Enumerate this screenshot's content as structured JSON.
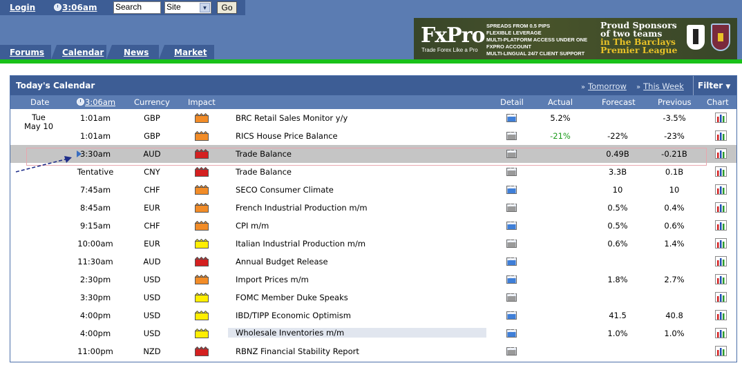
{
  "header": {
    "login_label": "Login",
    "time_label": "3:06am",
    "search_value": "Search",
    "site_select": "Site",
    "go_label": "Go",
    "nav": [
      {
        "label": "Forums"
      },
      {
        "label": "Calendar"
      },
      {
        "label": "News"
      },
      {
        "label": "Market"
      }
    ]
  },
  "ad": {
    "logo": "FxPro",
    "tagline": "Trade Forex Like a Pro",
    "features": [
      "SPREADS FROM 0.5 PIPS",
      "FLEXIBLE LEVERAGE",
      "MULTI-PLATFORM ACCESS UNDER ONE",
      "FXPRO ACCOUNT",
      "MULTI-LINGUAL 24/7 CLIENT SUPPORT"
    ],
    "sponsor_line1": "Proud Sponsors",
    "sponsor_line2": "of two teams",
    "sponsor_line3": "in The Barclays",
    "sponsor_line4": "Premier League"
  },
  "calendar": {
    "title": "Today's Calendar",
    "tomorrow_link": "Tomorrow",
    "this_week_link": "This Week",
    "filter_label": "Filter",
    "columns": {
      "date": "Date",
      "time": "3:06am",
      "currency": "Currency",
      "impact": "Impact",
      "detail": "Detail",
      "actual": "Actual",
      "forecast": "Forecast",
      "previous": "Previous",
      "chart": "Chart"
    },
    "date_label_line1": "Tue",
    "date_label_line2": "May 10",
    "rows": [
      {
        "time": "1:01am",
        "currency": "GBP",
        "impact": "medium",
        "event": "BRC Retail Sales Monitor y/y",
        "actual": "5.2%",
        "forecast": "",
        "previous": "-3.5%",
        "detail": "new"
      },
      {
        "time": "1:01am",
        "currency": "GBP",
        "impact": "medium",
        "event": "RICS House Price Balance",
        "actual": "-21%",
        "forecast": "-22%",
        "previous": "-23%",
        "detail": "seen"
      },
      {
        "time": "3:30am",
        "currency": "AUD",
        "impact": "high",
        "event": "Trade Balance",
        "actual": "",
        "forecast": "0.49B",
        "previous": "-0.21B",
        "detail": "seen"
      },
      {
        "time": "Tentative",
        "currency": "CNY",
        "impact": "high",
        "event": "Trade Balance",
        "actual": "",
        "forecast": "3.3B",
        "previous": "0.1B",
        "detail": "seen"
      },
      {
        "time": "7:45am",
        "currency": "CHF",
        "impact": "medium",
        "event": "SECO Consumer Climate",
        "actual": "",
        "forecast": "10",
        "previous": "10",
        "detail": "new"
      },
      {
        "time": "8:45am",
        "currency": "EUR",
        "impact": "medium",
        "event": "French Industrial Production m/m",
        "actual": "",
        "forecast": "0.5%",
        "previous": "0.4%",
        "detail": "seen"
      },
      {
        "time": "9:15am",
        "currency": "CHF",
        "impact": "medium",
        "event": "CPI m/m",
        "actual": "",
        "forecast": "0.5%",
        "previous": "0.6%",
        "detail": "new"
      },
      {
        "time": "10:00am",
        "currency": "EUR",
        "impact": "low",
        "event": "Italian Industrial Production m/m",
        "actual": "",
        "forecast": "0.6%",
        "previous": "1.4%",
        "detail": "seen"
      },
      {
        "time": "11:30am",
        "currency": "AUD",
        "impact": "high",
        "event": "Annual Budget Release",
        "actual": "",
        "forecast": "",
        "previous": "",
        "detail": "new"
      },
      {
        "time": "2:30pm",
        "currency": "USD",
        "impact": "medium",
        "event": "Import Prices m/m",
        "actual": "",
        "forecast": "1.8%",
        "previous": "2.7%",
        "detail": "new"
      },
      {
        "time": "3:30pm",
        "currency": "USD",
        "impact": "low",
        "event": "FOMC Member Duke Speaks",
        "actual": "",
        "forecast": "",
        "previous": "",
        "detail": "seen"
      },
      {
        "time": "4:00pm",
        "currency": "USD",
        "impact": "low",
        "event": "IBD/TIPP Economic Optimism",
        "actual": "",
        "forecast": "41.5",
        "previous": "40.8",
        "detail": "new"
      },
      {
        "time": "4:00pm",
        "currency": "USD",
        "impact": "low",
        "event": "Wholesale Inventories m/m",
        "actual": "",
        "forecast": "1.0%",
        "previous": "1.0%",
        "detail": "new"
      },
      {
        "time": "11:00pm",
        "currency": "NZD",
        "impact": "high",
        "event": "RBNZ Financial Stability Report",
        "actual": "",
        "forecast": "",
        "previous": "",
        "detail": "seen"
      }
    ]
  },
  "colors": {
    "high_impact": "#d42020",
    "medium_impact": "#f28c28",
    "low_impact": "#ffee00",
    "positive_actual": "#1a9a1a",
    "header_dark": "#3d5d95",
    "header_light": "#5b7cb2"
  }
}
